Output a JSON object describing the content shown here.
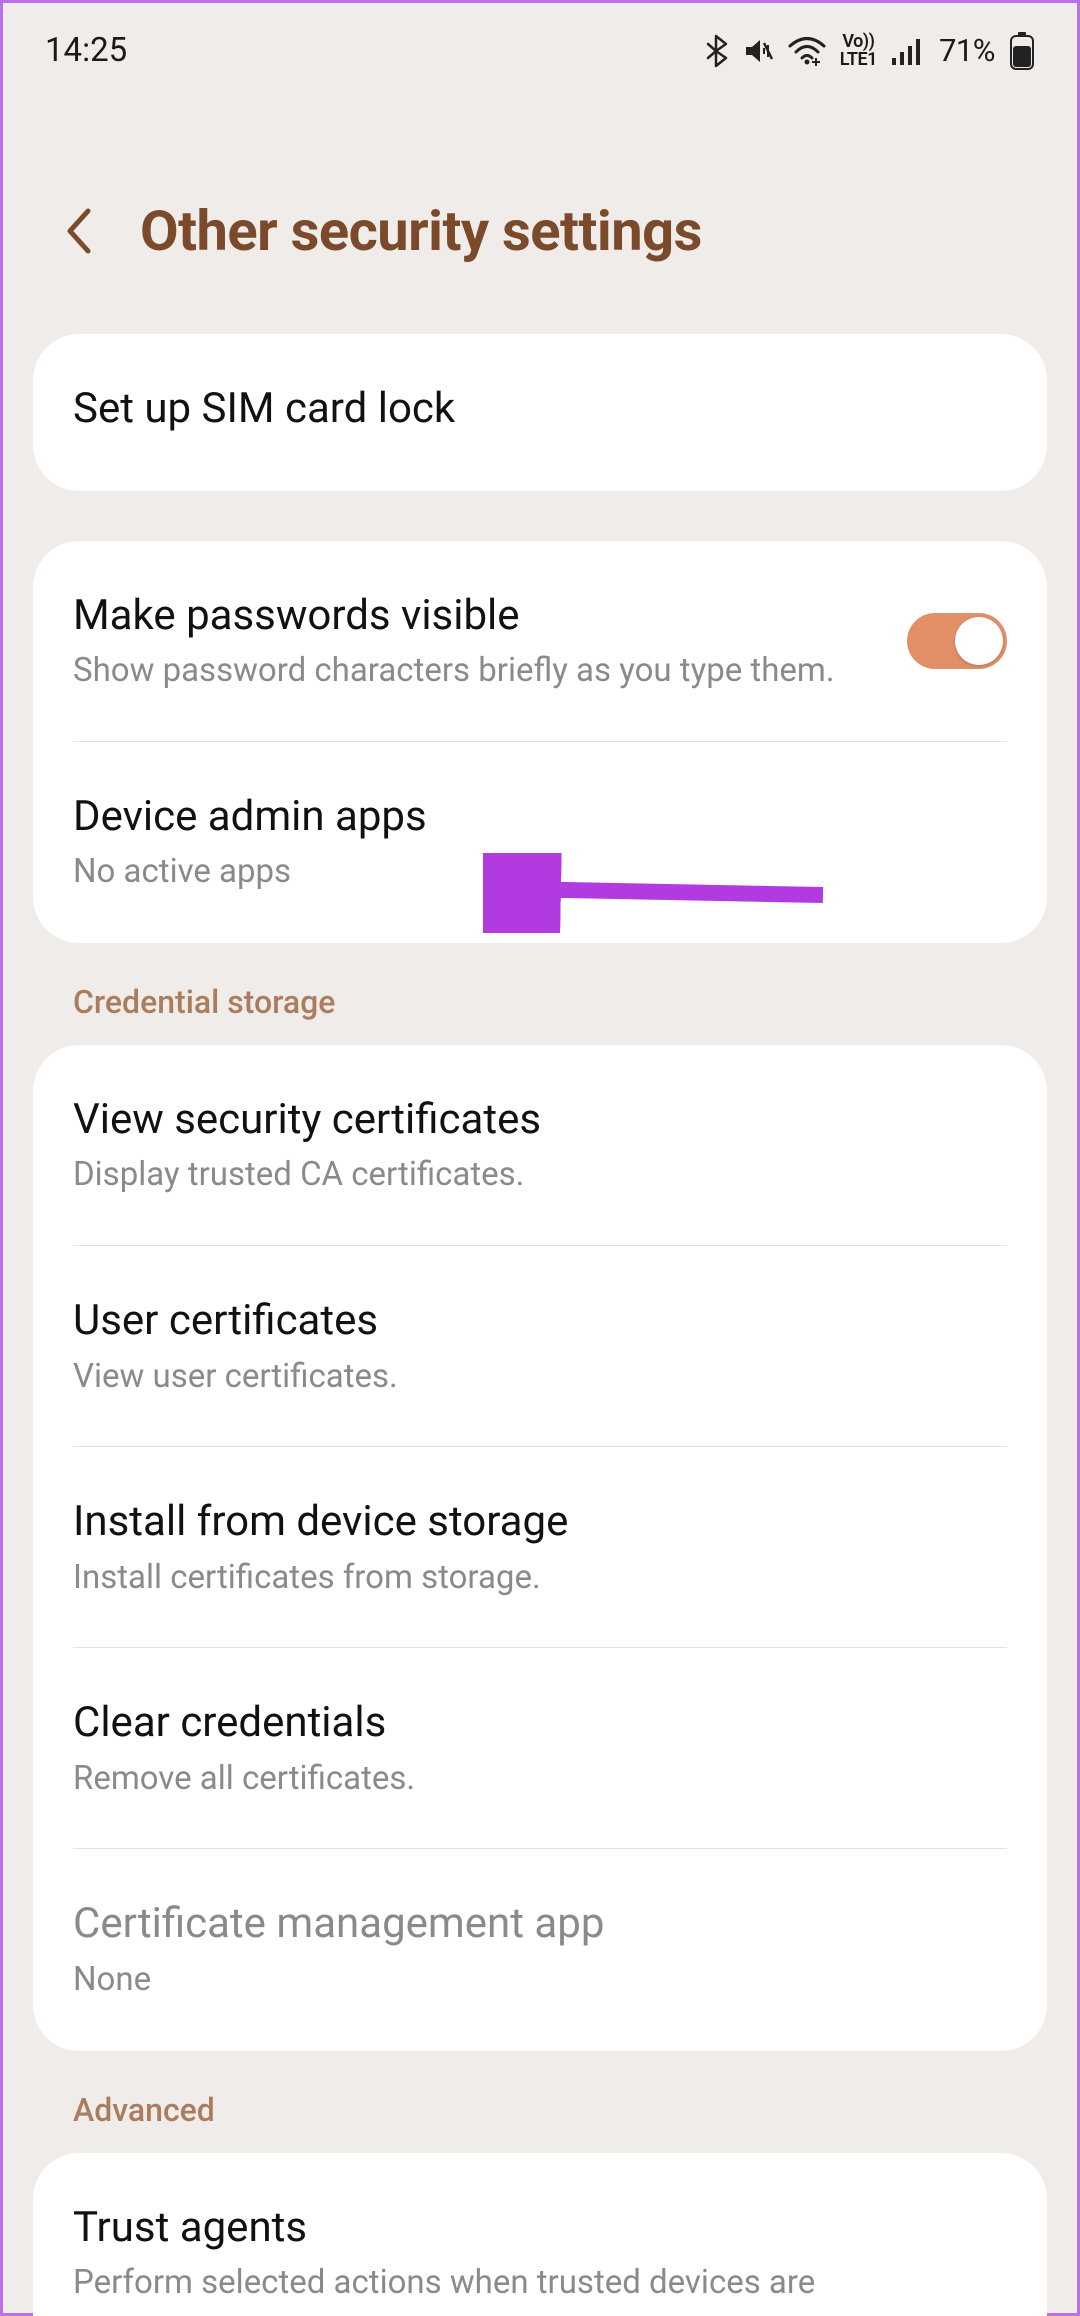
{
  "status": {
    "time": "14:25",
    "battery_pct": "71%"
  },
  "header": {
    "title": "Other security settings"
  },
  "groups": [
    {
      "items": [
        {
          "title": "Set up SIM card lock",
          "sub": ""
        }
      ]
    },
    {
      "items": [
        {
          "title": "Make passwords visible",
          "sub": "Show password characters briefly as you type them.",
          "toggle": true
        },
        {
          "title": "Device admin apps",
          "sub": "No active apps"
        }
      ]
    },
    {
      "header": "Credential storage",
      "items": [
        {
          "title": "View security certificates",
          "sub": "Display trusted CA certificates."
        },
        {
          "title": "User certificates",
          "sub": "View user certificates."
        },
        {
          "title": "Install from device storage",
          "sub": "Install certificates from storage."
        },
        {
          "title": "Clear credentials",
          "sub": "Remove all certificates."
        },
        {
          "title": "Certificate management app",
          "sub": "None",
          "disabled": true
        }
      ]
    },
    {
      "header": "Advanced",
      "items": [
        {
          "title": "Trust agents",
          "sub": "Perform selected actions when trusted devices are"
        }
      ]
    }
  ]
}
